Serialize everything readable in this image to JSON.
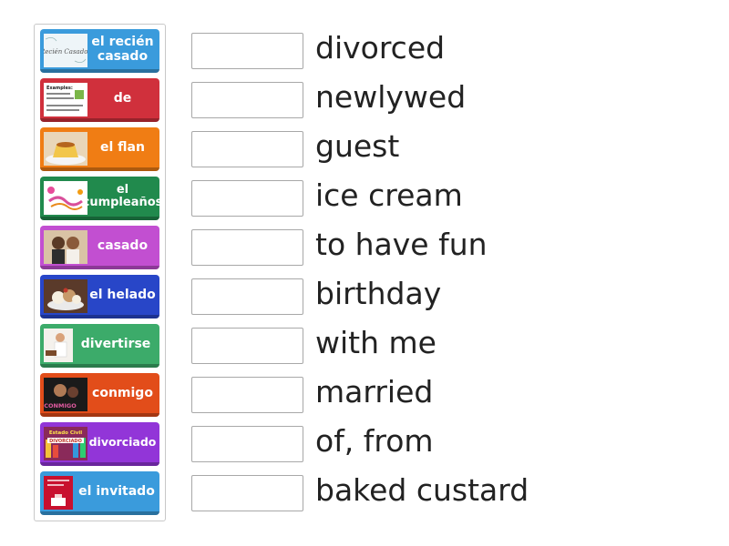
{
  "tiles": [
    {
      "label": "el recién casado",
      "color": "#3a9bdc",
      "icon": "wedding-invitation-icon"
    },
    {
      "label": "de",
      "color": "#d0303c",
      "icon": "example-sheet-icon"
    },
    {
      "label": "el flan",
      "color": "#f07d14",
      "icon": "flan-dessert-icon"
    },
    {
      "label": "el cumpleaños",
      "color": "#218a4d",
      "icon": "birthday-text-icon"
    },
    {
      "label": "casado",
      "color": "#c24fd1",
      "icon": "married-couple-icon"
    },
    {
      "label": "el helado",
      "color": "#2846c8",
      "icon": "ice-cream-sundae-icon"
    },
    {
      "label": "divertirse",
      "color": "#3cab6a",
      "icon": "chef-cooking-icon"
    },
    {
      "label": "conmigo",
      "color": "#e24d1a",
      "icon": "conmigo-photo-icon"
    },
    {
      "label": "divorciado",
      "color": "#9235d8",
      "icon": "estado-civil-divorciado-icon"
    },
    {
      "label": "el invitado",
      "color": "#3a9bdc",
      "icon": "invitation-card-icon"
    }
  ],
  "definitions": [
    "divorced",
    "newlywed",
    "guest",
    "ice cream",
    "to have fun",
    "birthday",
    "with me",
    "married",
    "of, from",
    "baked custard"
  ],
  "image_text": {
    "wedding": "Recién Casados",
    "example_title": "Examples:",
    "conmigo": "CONMIGO",
    "estado_civil": "Estado Civil",
    "divorciado_badge": "DIVORCIADO"
  }
}
